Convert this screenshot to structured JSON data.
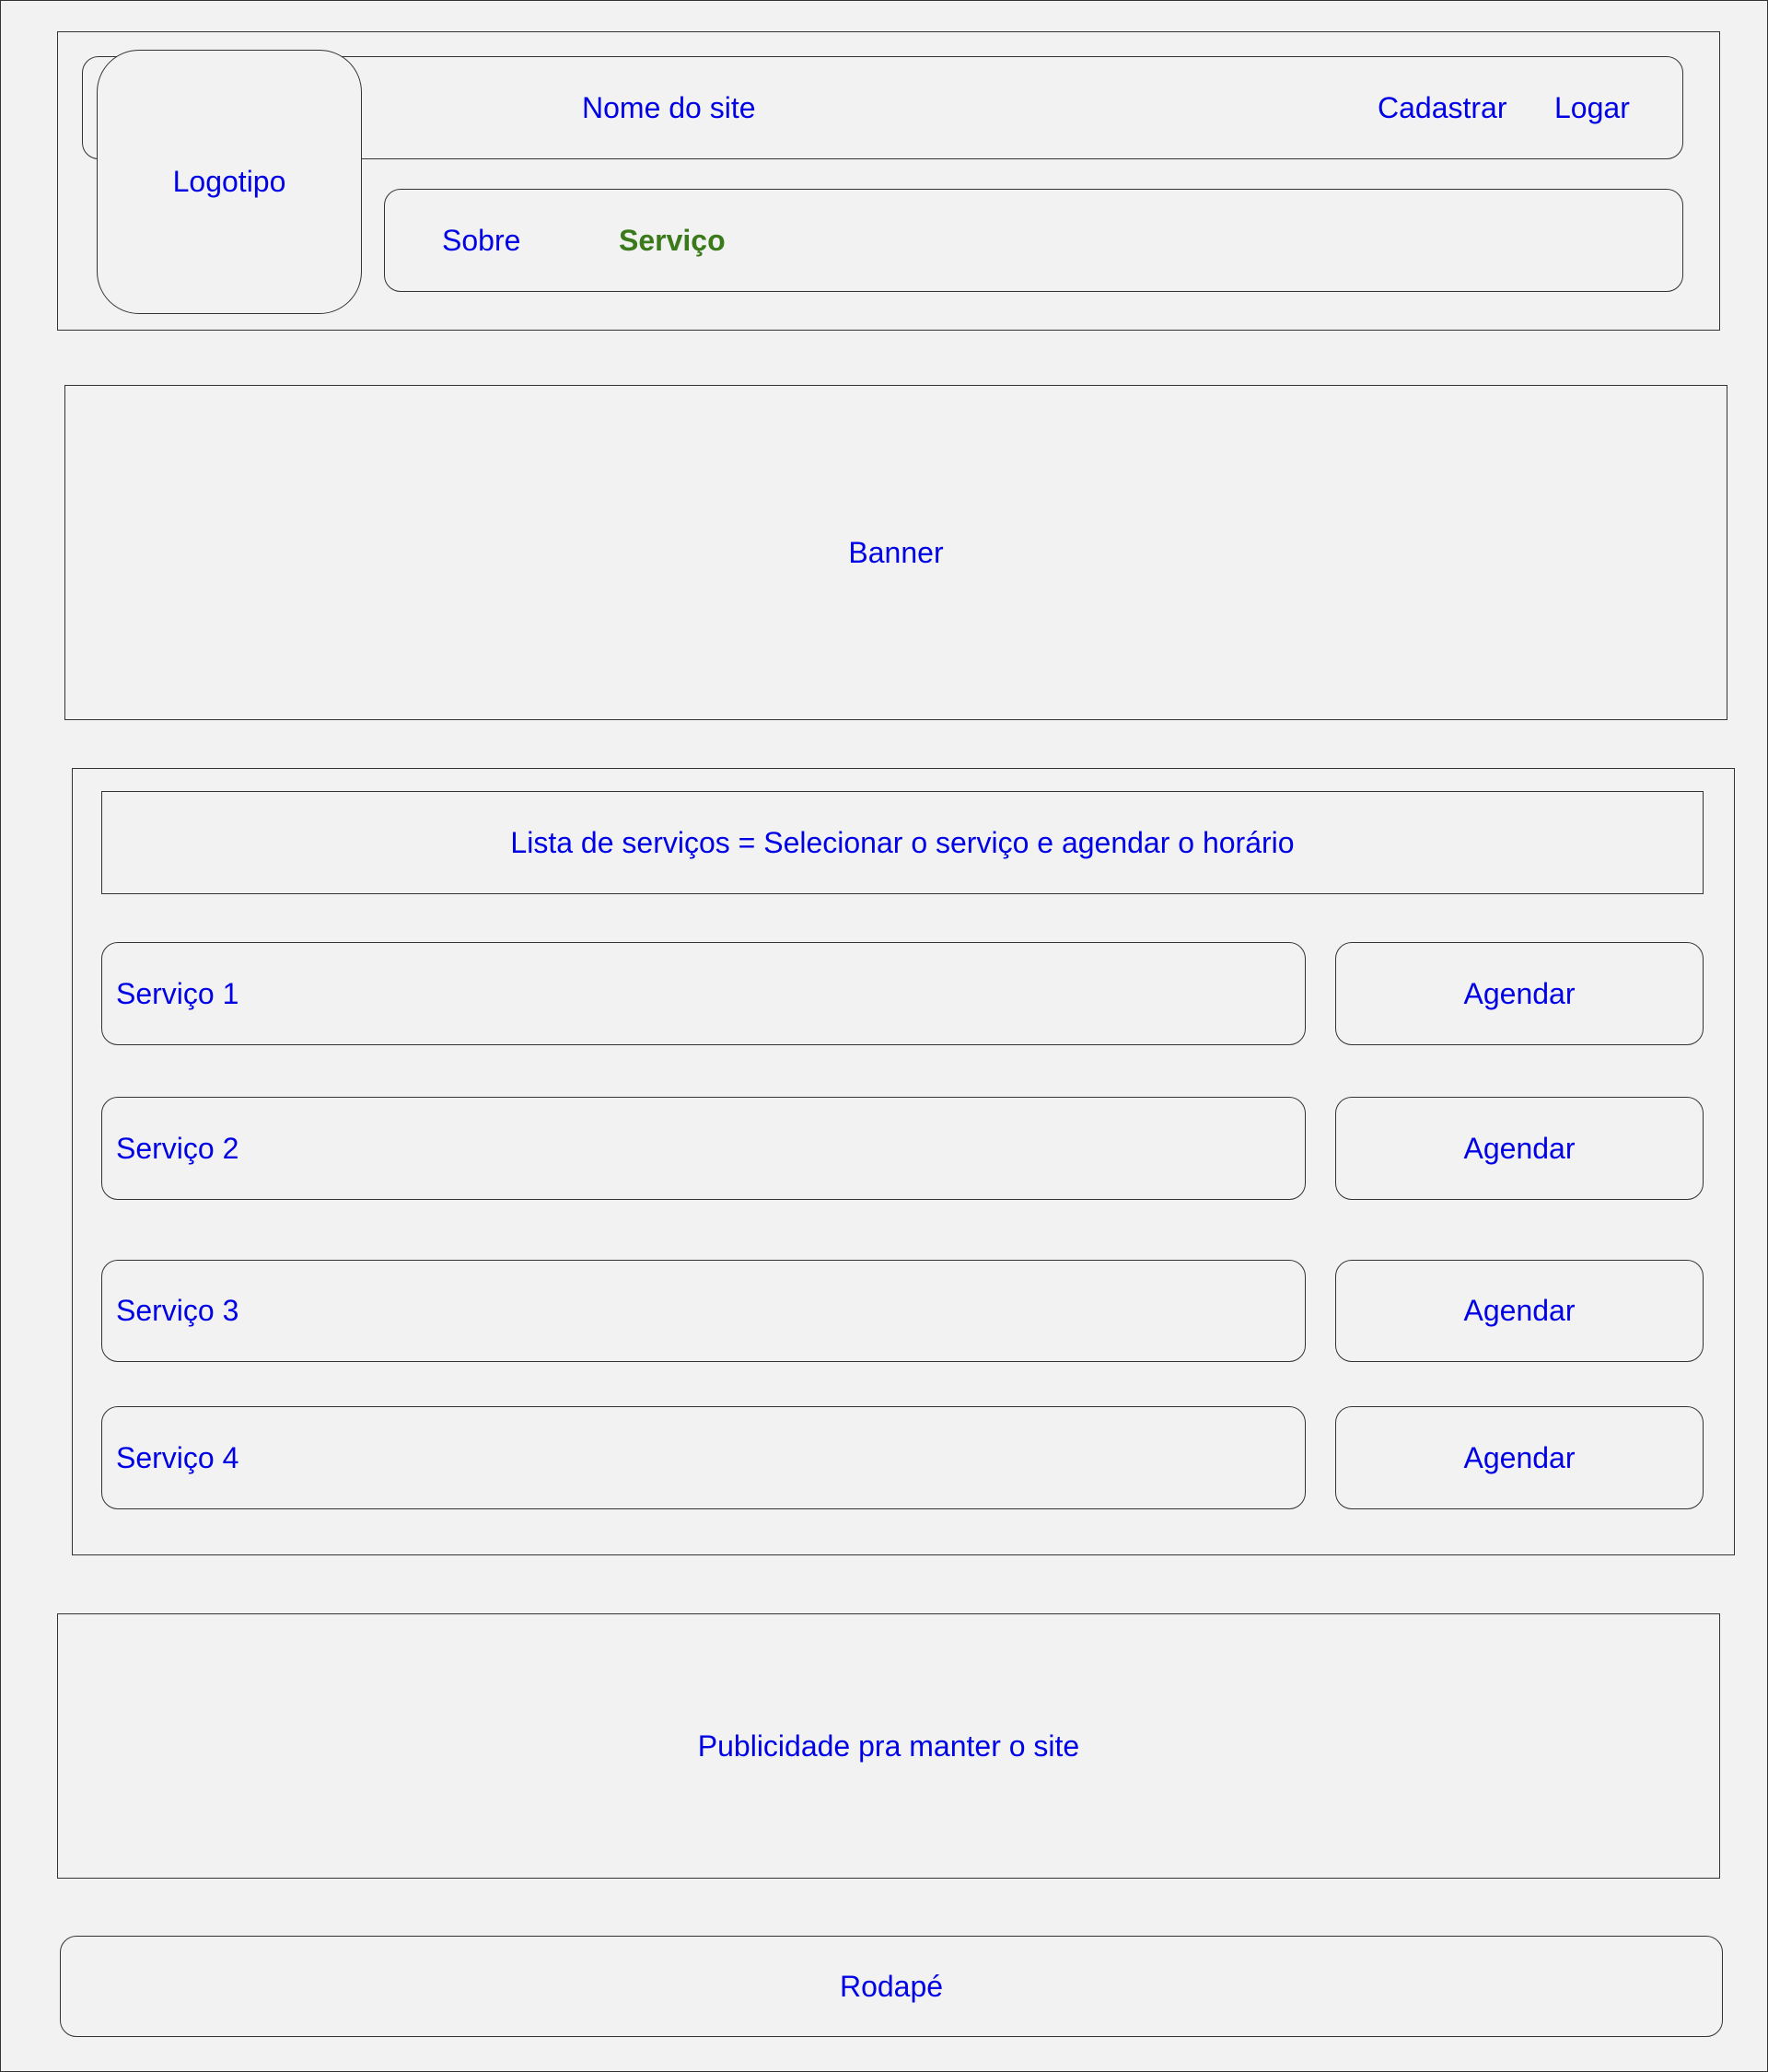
{
  "header": {
    "site_name": "Nome do site",
    "logo_label": "Logotipo",
    "auth": {
      "signup_label": "Cadastrar",
      "login_label": "Logar"
    },
    "nav": {
      "about_label": "Sobre",
      "services_label": "Serviço"
    }
  },
  "banner": {
    "label": "Banner"
  },
  "services": {
    "heading": "Lista de serviços = Selecionar o serviço e agendar o horário",
    "items": [
      {
        "name": "Serviço 1",
        "action": "Agendar"
      },
      {
        "name": "Serviço 2",
        "action": "Agendar"
      },
      {
        "name": "Serviço 3",
        "action": "Agendar"
      },
      {
        "name": "Serviço 4",
        "action": "Agendar"
      }
    ]
  },
  "ad": {
    "label": "Publicidade pra manter o site"
  },
  "footer": {
    "label": "Rodapé"
  },
  "colors": {
    "text": "#0000e6",
    "active_nav": "#3a7a1a",
    "background": "#f2f2f2",
    "border": "#333333"
  }
}
